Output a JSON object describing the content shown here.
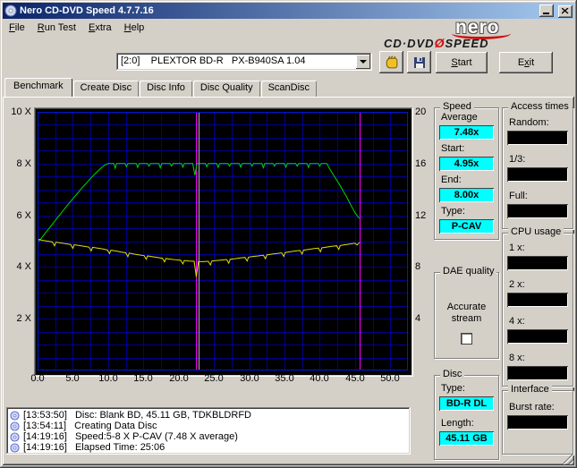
{
  "window": {
    "title": "Nero CD-DVD Speed 4.7.7.16"
  },
  "menu": {
    "items": [
      {
        "pre": "",
        "u": "F",
        "post": "ile"
      },
      {
        "pre": "",
        "u": "R",
        "post": "un Test"
      },
      {
        "pre": "",
        "u": "E",
        "post": "xtra"
      },
      {
        "pre": "",
        "u": "H",
        "post": "elp"
      }
    ]
  },
  "logo": {
    "brand": "nero",
    "product_left": "CD·DVD",
    "product_slash": "Ø",
    "product_right": "SPEED"
  },
  "toolbar": {
    "drive_value": "[2:0]    PLEXTOR BD-R   PX-B940SA 1.04",
    "start": {
      "pre": "",
      "u": "S",
      "post": "tart"
    },
    "exit": {
      "pre": "E",
      "u": "x",
      "post": "it"
    }
  },
  "tabs": [
    "Benchmark",
    "Create Disc",
    "Disc Info",
    "Disc Quality",
    "ScanDisc"
  ],
  "speed_panel": {
    "title": "Speed",
    "average_label": "Average",
    "average_value": "7.48x",
    "start_label": "Start:",
    "start_value": "4.95x",
    "end_label": "End:",
    "end_value": "8.00x",
    "type_label": "Type:",
    "type_value": "P-CAV"
  },
  "access_panel": {
    "title": "Access times",
    "random_label": "Random:",
    "third_label": "1/3:",
    "full_label": "Full:"
  },
  "cpu_panel": {
    "title": "CPU usage",
    "x1_label": "1 x:",
    "x2_label": "2 x:",
    "x4_label": "4 x:",
    "x8_label": "8 x:"
  },
  "dae_panel": {
    "title": "DAE quality",
    "stream_label": "Accurate stream"
  },
  "disc_panel": {
    "title": "Disc",
    "type_label": "Type:",
    "type_value": "BD-R DL",
    "length_label": "Length:",
    "length_value": "45.11 GB"
  },
  "interface_panel": {
    "title": "Interface",
    "burst_label": "Burst rate:"
  },
  "log": {
    "entries": [
      {
        "time": "[13:53:50]",
        "text": "Disc: Blank BD, 45.11 GB, TDKBLDRFD"
      },
      {
        "time": "[13:54:11]",
        "text": "Creating Data Disc"
      },
      {
        "time": "[14:19:16]",
        "text": "Speed:5-8 X P-CAV (7.48 X average)"
      },
      {
        "time": "[14:19:16]",
        "text": "Elapsed Time: 25:06"
      }
    ]
  },
  "chart_data": {
    "type": "line",
    "x_axis": {
      "min": 0,
      "max": 52.5,
      "grid_step": 2.5,
      "tick_values": [
        0,
        5,
        10,
        15,
        20,
        25,
        30,
        35,
        40,
        45,
        50
      ],
      "tick_labels": [
        "0.0",
        "5.0",
        "10.0",
        "15.0",
        "20.0",
        "25.0",
        "30.0",
        "35.0",
        "40.0",
        "45.0",
        "50.0"
      ]
    },
    "y_axis_left": {
      "min": 0,
      "max": 10,
      "grid_step": 0.5,
      "tick_values": [
        10,
        8,
        6,
        4,
        2
      ],
      "tick_labels": [
        "10 X",
        "8 X",
        "6 X",
        "4 X",
        "2 X"
      ]
    },
    "y_axis_right": {
      "tick_labels": [
        "20",
        "16",
        "12",
        "8",
        "4"
      ]
    },
    "colors": {
      "plot_bg": "#000000",
      "grid": "#00008f",
      "border": "#0018d8"
    },
    "vlines": [
      {
        "x": 22.5,
        "color": "#ff00ff"
      },
      {
        "x": 22.85,
        "color": "#b0b0b0"
      },
      {
        "x": 45.6,
        "color": "#ff00ff"
      }
    ],
    "series": [
      {
        "name": "write-speed-x",
        "color": "#00d800",
        "points": [
          [
            0,
            4.95
          ],
          [
            0.5,
            5.1
          ],
          [
            1,
            5.28
          ],
          [
            1.5,
            5.45
          ],
          [
            2,
            5.62
          ],
          [
            2.5,
            5.8
          ],
          [
            3,
            5.97
          ],
          [
            3.5,
            6.14
          ],
          [
            4,
            6.31
          ],
          [
            4.5,
            6.48
          ],
          [
            5,
            6.64
          ],
          [
            5.5,
            6.8
          ],
          [
            6,
            6.96
          ],
          [
            6.5,
            7.12
          ],
          [
            7,
            7.27
          ],
          [
            7.5,
            7.42
          ],
          [
            8,
            7.56
          ],
          [
            8.5,
            7.7
          ],
          [
            9,
            7.83
          ],
          [
            9.5,
            7.94
          ],
          [
            10,
            8
          ],
          [
            10.8,
            8
          ],
          [
            11,
            7.82
          ],
          [
            11.2,
            8
          ],
          [
            12.4,
            8
          ],
          [
            12.6,
            7.88
          ],
          [
            12.8,
            8
          ],
          [
            14,
            8
          ],
          [
            14.2,
            7.85
          ],
          [
            14.4,
            8
          ],
          [
            15.6,
            8
          ],
          [
            15.8,
            7.9
          ],
          [
            16,
            8
          ],
          [
            17.2,
            8
          ],
          [
            17.4,
            7.84
          ],
          [
            17.6,
            8
          ],
          [
            18.8,
            8
          ],
          [
            19,
            7.9
          ],
          [
            19.2,
            8
          ],
          [
            20.4,
            8
          ],
          [
            20.6,
            7.86
          ],
          [
            20.8,
            8
          ],
          [
            22,
            8
          ],
          [
            22.3,
            7.55
          ],
          [
            22.6,
            8
          ],
          [
            23.8,
            8
          ],
          [
            24,
            7.88
          ],
          [
            24.2,
            8
          ],
          [
            25.4,
            8
          ],
          [
            25.6,
            7.85
          ],
          [
            25.8,
            8
          ],
          [
            27,
            8
          ],
          [
            27.2,
            7.9
          ],
          [
            27.4,
            8
          ],
          [
            28.6,
            8
          ],
          [
            28.8,
            7.86
          ],
          [
            29,
            8
          ],
          [
            30.2,
            8
          ],
          [
            30.4,
            7.9
          ],
          [
            30.6,
            8
          ],
          [
            31.8,
            8
          ],
          [
            32,
            7.84
          ],
          [
            32.2,
            8
          ],
          [
            33.4,
            8
          ],
          [
            33.6,
            7.9
          ],
          [
            33.8,
            8
          ],
          [
            35,
            8
          ],
          [
            35.2,
            7.86
          ],
          [
            35.4,
            8
          ],
          [
            36.6,
            8
          ],
          [
            36.8,
            7.9
          ],
          [
            37,
            8
          ],
          [
            38.2,
            8
          ],
          [
            38.4,
            7.85
          ],
          [
            38.6,
            8
          ],
          [
            39.8,
            8
          ],
          [
            40,
            7.9
          ],
          [
            40.2,
            8
          ],
          [
            41,
            8
          ],
          [
            41.4,
            7.8
          ],
          [
            41.8,
            7.62
          ],
          [
            42.2,
            7.45
          ],
          [
            42.6,
            7.28
          ],
          [
            43,
            7.1
          ],
          [
            43.4,
            6.9
          ],
          [
            43.8,
            6.72
          ],
          [
            44.2,
            6.5
          ],
          [
            44.6,
            6.3
          ],
          [
            45,
            6.1
          ],
          [
            45.4,
            5.95
          ],
          [
            45.6,
            5.88
          ]
        ]
      },
      {
        "name": "rotation-speed",
        "color": "#e0e000",
        "points": [
          [
            0,
            5.08
          ],
          [
            0.7,
            5.03
          ],
          [
            1.4,
            5
          ],
          [
            2.1,
            4.97
          ],
          [
            2.4,
            4.82
          ],
          [
            2.6,
            4.96
          ],
          [
            3.3,
            4.93
          ],
          [
            4,
            4.9
          ],
          [
            4.7,
            4.87
          ],
          [
            5,
            4.72
          ],
          [
            5.2,
            4.86
          ],
          [
            5.9,
            4.83
          ],
          [
            6.6,
            4.8
          ],
          [
            7.3,
            4.77
          ],
          [
            7.6,
            4.62
          ],
          [
            7.8,
            4.76
          ],
          [
            8.5,
            4.73
          ],
          [
            9.2,
            4.7
          ],
          [
            9.9,
            4.66
          ],
          [
            10.2,
            4.52
          ],
          [
            10.4,
            4.65
          ],
          [
            11.1,
            4.62
          ],
          [
            11.8,
            4.58
          ],
          [
            12.5,
            4.55
          ],
          [
            12.8,
            4.4
          ],
          [
            13,
            4.54
          ],
          [
            13.7,
            4.5
          ],
          [
            14.4,
            4.47
          ],
          [
            15.1,
            4.44
          ],
          [
            15.4,
            4.3
          ],
          [
            15.6,
            4.43
          ],
          [
            16.3,
            4.4
          ],
          [
            17,
            4.37
          ],
          [
            17.7,
            4.34
          ],
          [
            18,
            4.2
          ],
          [
            18.2,
            4.33
          ],
          [
            18.9,
            4.3
          ],
          [
            19.6,
            4.28
          ],
          [
            20.3,
            4.26
          ],
          [
            20.6,
            4.12
          ],
          [
            20.8,
            4.25
          ],
          [
            21.5,
            4.23
          ],
          [
            22.2,
            4.22
          ],
          [
            22.5,
            3.62
          ],
          [
            22.8,
            4.21
          ],
          [
            23.5,
            4.21
          ],
          [
            24.2,
            4.22
          ],
          [
            24.5,
            4.08
          ],
          [
            24.7,
            4.23
          ],
          [
            25.4,
            4.25
          ],
          [
            26.1,
            4.27
          ],
          [
            26.8,
            4.29
          ],
          [
            27.1,
            4.15
          ],
          [
            27.3,
            4.3
          ],
          [
            28,
            4.32
          ],
          [
            28.7,
            4.35
          ],
          [
            29.4,
            4.37
          ],
          [
            29.7,
            4.23
          ],
          [
            29.9,
            4.38
          ],
          [
            30.6,
            4.41
          ],
          [
            31.3,
            4.43
          ],
          [
            32,
            4.46
          ],
          [
            32.3,
            4.32
          ],
          [
            32.5,
            4.47
          ],
          [
            33.2,
            4.5
          ],
          [
            33.9,
            4.52
          ],
          [
            34.6,
            4.55
          ],
          [
            34.9,
            4.41
          ],
          [
            35.1,
            4.56
          ],
          [
            35.8,
            4.59
          ],
          [
            36.5,
            4.62
          ],
          [
            37.2,
            4.64
          ],
          [
            37.5,
            4.5
          ],
          [
            37.7,
            4.65
          ],
          [
            38.4,
            4.68
          ],
          [
            39.1,
            4.71
          ],
          [
            39.8,
            4.73
          ],
          [
            40.1,
            4.59
          ],
          [
            40.3,
            4.74
          ],
          [
            41,
            4.77
          ],
          [
            41.7,
            4.8
          ],
          [
            42.4,
            4.82
          ],
          [
            42.7,
            4.68
          ],
          [
            42.9,
            4.83
          ],
          [
            43.6,
            4.86
          ],
          [
            44.3,
            4.89
          ],
          [
            45,
            4.92
          ],
          [
            45.3,
            4.85
          ],
          [
            45.6,
            4.95
          ]
        ]
      }
    ]
  }
}
